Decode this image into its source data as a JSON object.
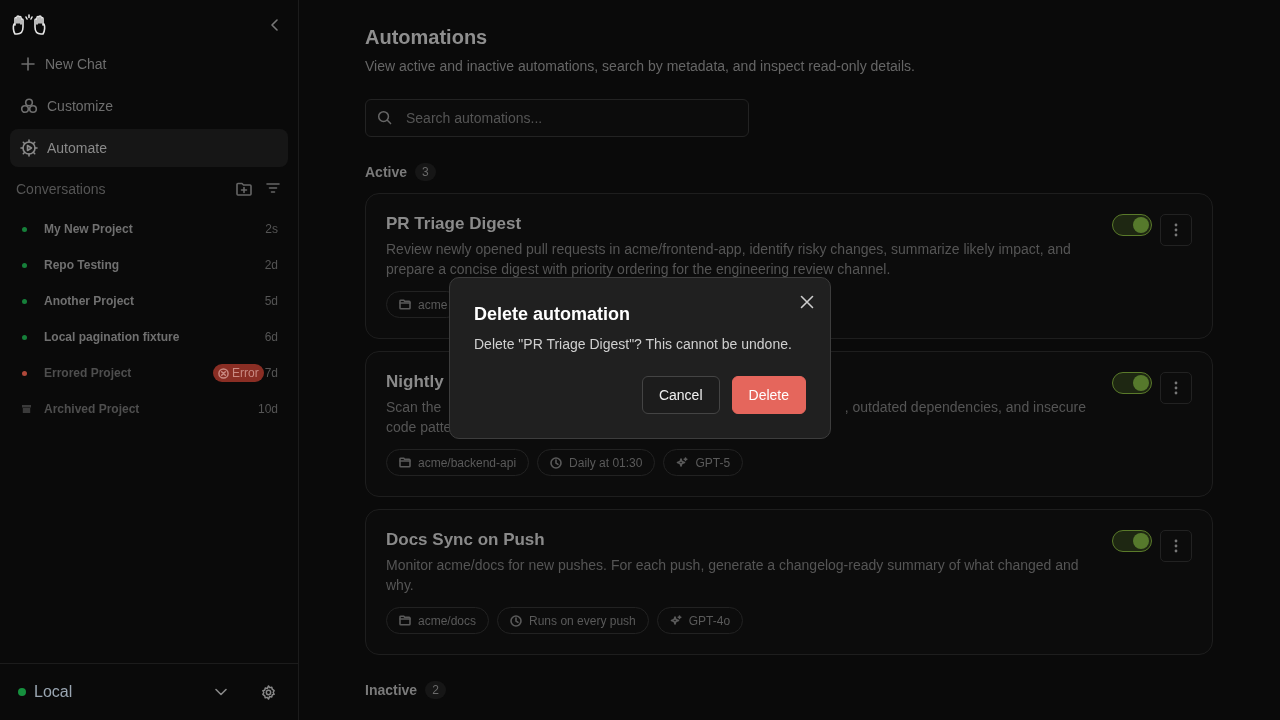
{
  "sidebar": {
    "nav": [
      {
        "label": "New Chat",
        "selected": false
      },
      {
        "label": "Customize",
        "selected": false
      },
      {
        "label": "Automate",
        "selected": true
      }
    ],
    "conversations_heading": "Conversations",
    "conversations": [
      {
        "kind": "active",
        "title": "My New Project",
        "time": "2s",
        "color": "#16803a"
      },
      {
        "kind": "active",
        "title": "Repo Testing",
        "time": "2d",
        "color": "#16803a"
      },
      {
        "kind": "active",
        "title": "Another Project",
        "time": "5d",
        "color": "#16803a"
      },
      {
        "kind": "active",
        "title": "Local pagination fixture",
        "time": "6d",
        "color": "#16803a"
      },
      {
        "kind": "error",
        "title": "Errored Project",
        "time": "7d",
        "color": "#b0483a",
        "badge": "Error"
      },
      {
        "kind": "archived",
        "title": "Archived Project",
        "time": "10d"
      }
    ],
    "environment": {
      "label": "Local",
      "color": "#16903e"
    }
  },
  "page": {
    "title": "Automations",
    "subtitle": "View active and inactive automations, search by metadata, and inspect read-only details.",
    "search": {
      "placeholder": "Search automations..."
    },
    "sections": [
      {
        "heading": "Active",
        "count": "3",
        "automations": [
          {
            "title": "PR Triage Digest",
            "description": [
              "Review newly opened pull requests in acme/frontend-app, identify risky changes, summarize likely impact, and prepare a concise digest with priority ordering for the engineering review channel."
            ],
            "on": true,
            "tags": [
              {
                "kind": "repo",
                "label": "acme"
              }
            ]
          },
          {
            "title": "Nightly",
            "description": [
              "Scan the",
              ", outdated dependencies, and insecure",
              "code patte"
            ],
            "on": true,
            "tags": [
              {
                "kind": "repo",
                "label": "acme/backend-api"
              },
              {
                "kind": "schedule",
                "label": "Daily at 01:30"
              },
              {
                "kind": "model",
                "label": "GPT-5"
              }
            ]
          },
          {
            "title": "Docs Sync on Push",
            "description": [
              "Monitor acme/docs for new pushes. For each push, generate a changelog-ready summary of what changed and why."
            ],
            "on": true,
            "tags": [
              {
                "kind": "repo",
                "label": "acme/docs"
              },
              {
                "kind": "schedule",
                "label": "Runs on every push"
              },
              {
                "kind": "model",
                "label": "GPT-4o"
              }
            ]
          }
        ]
      },
      {
        "heading": "Inactive",
        "count": "2"
      }
    ]
  },
  "dialog": {
    "title": "Delete automation",
    "message": "Delete \"PR Triage Digest\"? This cannot be undone.",
    "buttons": [
      {
        "kind": "secondary",
        "label": "Cancel"
      },
      {
        "kind": "danger",
        "label": "Delete"
      }
    ]
  }
}
